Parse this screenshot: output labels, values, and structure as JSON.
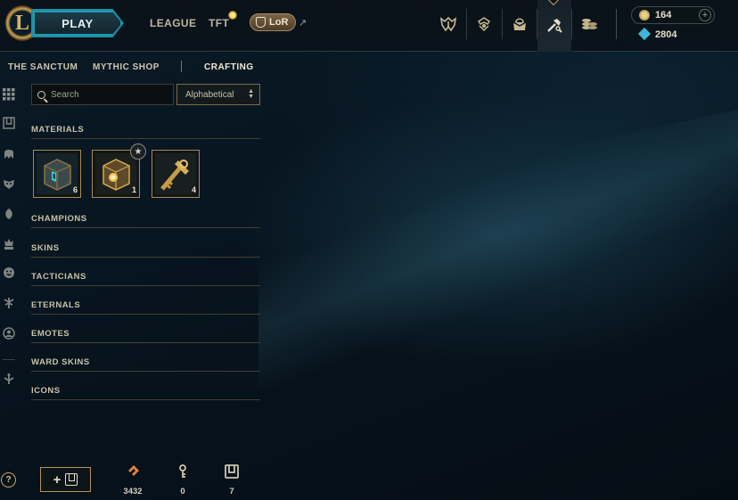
{
  "header": {
    "logo_letter": "L",
    "play_label": "PLAY",
    "nav": [
      "LEAGUE",
      "TFT"
    ],
    "lor_label": "LoR",
    "external_arrow": "↗",
    "icons": [
      "clash-icon",
      "ranked-icon",
      "store-icon",
      "loot-icon",
      "currency-icon"
    ],
    "active_icon": "loot-icon",
    "wallet": {
      "blue_essence": "164",
      "riot_points": "2804",
      "add_symbol": "+"
    }
  },
  "subnav": {
    "items": [
      "THE SANCTUM",
      "MYTHIC SHOP",
      "CRAFTING"
    ],
    "active": "CRAFTING"
  },
  "rail": {
    "icons": [
      "all-icon",
      "chest-icon",
      "champion-icon",
      "skin-icon",
      "tactician-icon",
      "eternal-icon",
      "emote-icon",
      "ward-icon",
      "profile-icon",
      "other-icon"
    ],
    "help": "?"
  },
  "toolbar": {
    "search_placeholder": "Search",
    "sort_value": "Alphabetical",
    "sort_arrows_up": "▲",
    "sort_arrows_down": "▼"
  },
  "categories": {
    "materials": "MATERIALS",
    "champions": "CHAMPIONS",
    "skins": "SKINS",
    "tacticians": "TACTICIANS",
    "eternals": "ETERNALS",
    "emotes": "EMOTES",
    "ward_skins": "WARD SKINS",
    "icons": "ICONS"
  },
  "materials": [
    {
      "name": "hextech-chest",
      "count": "6"
    },
    {
      "name": "masterwork-chest",
      "count": "1",
      "badge": "★"
    },
    {
      "name": "hextech-key",
      "count": "4"
    }
  ],
  "footer": {
    "add_symbol": "+",
    "stats": [
      {
        "icon": "orange-essence-icon",
        "value": "3432",
        "color": "#e0823a"
      },
      {
        "icon": "key-fragment-icon",
        "value": "0",
        "color": "#cfc6ae"
      },
      {
        "icon": "chest-icon",
        "value": "7",
        "color": "#cfc6ae"
      }
    ]
  },
  "colors": {
    "accent_gold": "#c8a15a",
    "accent_teal": "#1f8ea3",
    "blue_essence": "#e6d18a",
    "rp": "#3fb6d9"
  }
}
